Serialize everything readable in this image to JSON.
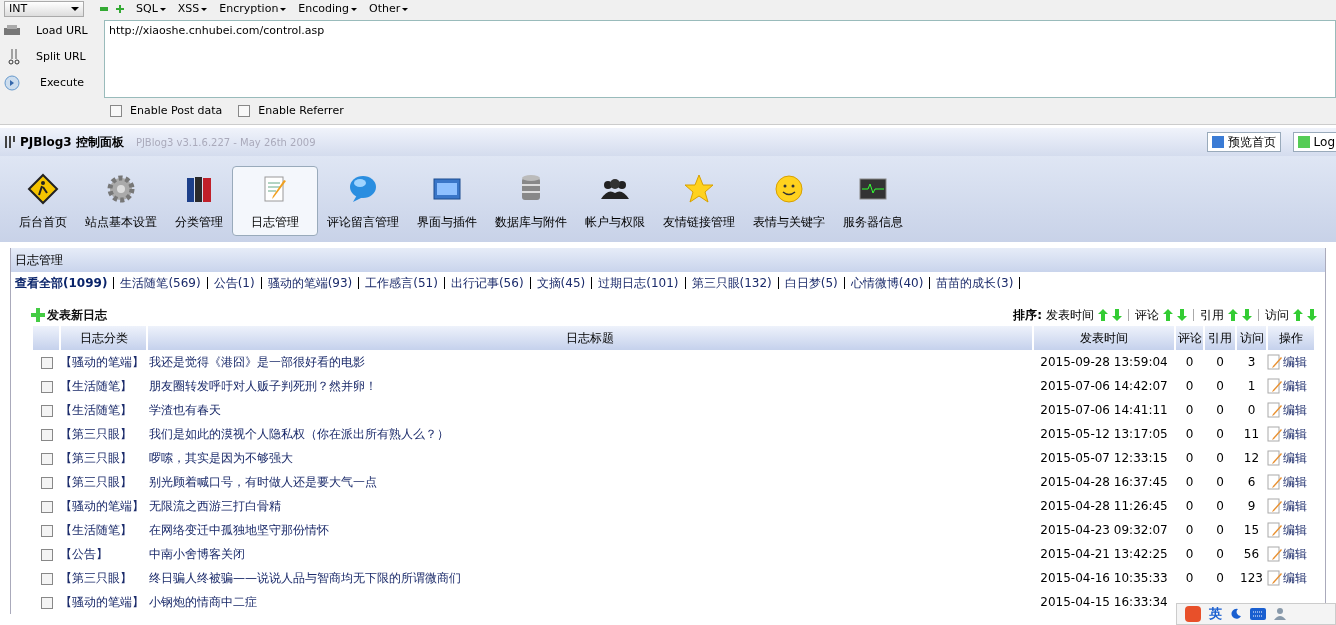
{
  "hackbar": {
    "mode": "INT",
    "menus": [
      "SQL",
      "XSS",
      "Encryption",
      "Encoding",
      "Other"
    ],
    "actions": [
      "Load URL",
      "Split URL",
      "Execute"
    ],
    "url": "http://xiaoshe.cnhubei.com/control.asp",
    "options": [
      {
        "label": "Enable Post data",
        "checked": false
      },
      {
        "label": "Enable Referrer",
        "checked": false
      }
    ]
  },
  "header": {
    "title": "PJBlog3 控制面板",
    "version": "PJBlog3 v3.1.6.227 - May 26th 2009",
    "buttons": [
      "预览首页",
      "Log"
    ]
  },
  "nav": [
    {
      "label": "后台首页",
      "selected": false
    },
    {
      "label": "站点基本设置",
      "selected": false
    },
    {
      "label": "分类管理",
      "selected": false
    },
    {
      "label": "日志管理",
      "selected": true
    },
    {
      "label": "评论留言管理",
      "selected": false
    },
    {
      "label": "界面与插件",
      "selected": false
    },
    {
      "label": "数据库与附件",
      "selected": false
    },
    {
      "label": "帐户与权限",
      "selected": false
    },
    {
      "label": "友情链接管理",
      "selected": false
    },
    {
      "label": "表情与关键字",
      "selected": false
    },
    {
      "label": "服务器信息",
      "selected": false
    }
  ],
  "panel": {
    "title": "日志管理",
    "categories": [
      {
        "label": "查看全部(1099)",
        "selected": true
      },
      {
        "label": "生活随笔(569)",
        "selected": false
      },
      {
        "label": "公告(1)",
        "selected": false
      },
      {
        "label": "骚动的笔端(93)",
        "selected": false
      },
      {
        "label": "工作感言(51)",
        "selected": false
      },
      {
        "label": "出行记事(56)",
        "selected": false
      },
      {
        "label": "文摘(45)",
        "selected": false
      },
      {
        "label": "过期日志(101)",
        "selected": false
      },
      {
        "label": "第三只眼(132)",
        "selected": false
      },
      {
        "label": "白日梦(5)",
        "selected": false
      },
      {
        "label": "心情微博(40)",
        "selected": false
      },
      {
        "label": "苗苗的成长(3)",
        "selected": false
      }
    ],
    "new_post": "发表新日志",
    "sort": {
      "label": "排序:",
      "fields": [
        "发表时间",
        "评论",
        "引用",
        "访问"
      ]
    },
    "table": {
      "columns": [
        "日志分类",
        "日志标题",
        "发表时间",
        "评论",
        "引用",
        "访问",
        "操作"
      ],
      "rows": [
        {
          "checked": false,
          "category": "【骚动的笔端】",
          "title": "我还是觉得《港囧》是一部很好看的电影",
          "time": "2015-09-28 13:59:04",
          "comments": "0",
          "trackbacks": "0",
          "visits": "3",
          "action": "编辑"
        },
        {
          "checked": false,
          "category": "【生活随笔】",
          "title": "朋友圈转发呼吁对人贩子判死刑？然并卵！",
          "time": "2015-07-06 14:42:07",
          "comments": "0",
          "trackbacks": "0",
          "visits": "1",
          "action": "编辑"
        },
        {
          "checked": false,
          "category": "【生活随笔】",
          "title": "学渣也有春天",
          "time": "2015-07-06 14:41:11",
          "comments": "0",
          "trackbacks": "0",
          "visits": "0",
          "action": "编辑"
        },
        {
          "checked": false,
          "category": "【第三只眼】",
          "title": "我们是如此的漠视个人隐私权（你在派出所有熟人么？）",
          "time": "2015-05-12 13:17:05",
          "comments": "0",
          "trackbacks": "0",
          "visits": "11",
          "action": "编辑"
        },
        {
          "checked": false,
          "category": "【第三只眼】",
          "title": "啰嗦，其实是因为不够强大",
          "time": "2015-05-07 12:33:15",
          "comments": "0",
          "trackbacks": "0",
          "visits": "12",
          "action": "编辑"
        },
        {
          "checked": false,
          "category": "【第三只眼】",
          "title": "别光顾着喊口号，有时做人还是要大气一点",
          "time": "2015-04-28 16:37:45",
          "comments": "0",
          "trackbacks": "0",
          "visits": "6",
          "action": "编辑"
        },
        {
          "checked": false,
          "category": "【骚动的笔端】",
          "title": "无限流之西游三打白骨精",
          "time": "2015-04-28 11:26:45",
          "comments": "0",
          "trackbacks": "0",
          "visits": "9",
          "action": "编辑"
        },
        {
          "checked": false,
          "category": "【生活随笔】",
          "title": "在网络变迁中孤独地坚守那份情怀",
          "time": "2015-04-23 09:32:07",
          "comments": "0",
          "trackbacks": "0",
          "visits": "15",
          "action": "编辑"
        },
        {
          "checked": false,
          "category": "【公告】",
          "title": "中南小舍博客关闭",
          "time": "2015-04-21 13:42:25",
          "comments": "0",
          "trackbacks": "0",
          "visits": "56",
          "action": "编辑"
        },
        {
          "checked": false,
          "category": "【第三只眼】",
          "title": "终日骗人终被骗——说说人品与智商均无下限的所谓微商们",
          "time": "2015-04-16 10:35:33",
          "comments": "0",
          "trackbacks": "0",
          "visits": "123",
          "action": "编辑"
        },
        {
          "checked": false,
          "category": "【骚动的笔端】",
          "title": "小钢炮的情商中二症",
          "time": "2015-04-15 16:33:34"
        }
      ]
    }
  },
  "ime": {
    "mode": "英"
  }
}
